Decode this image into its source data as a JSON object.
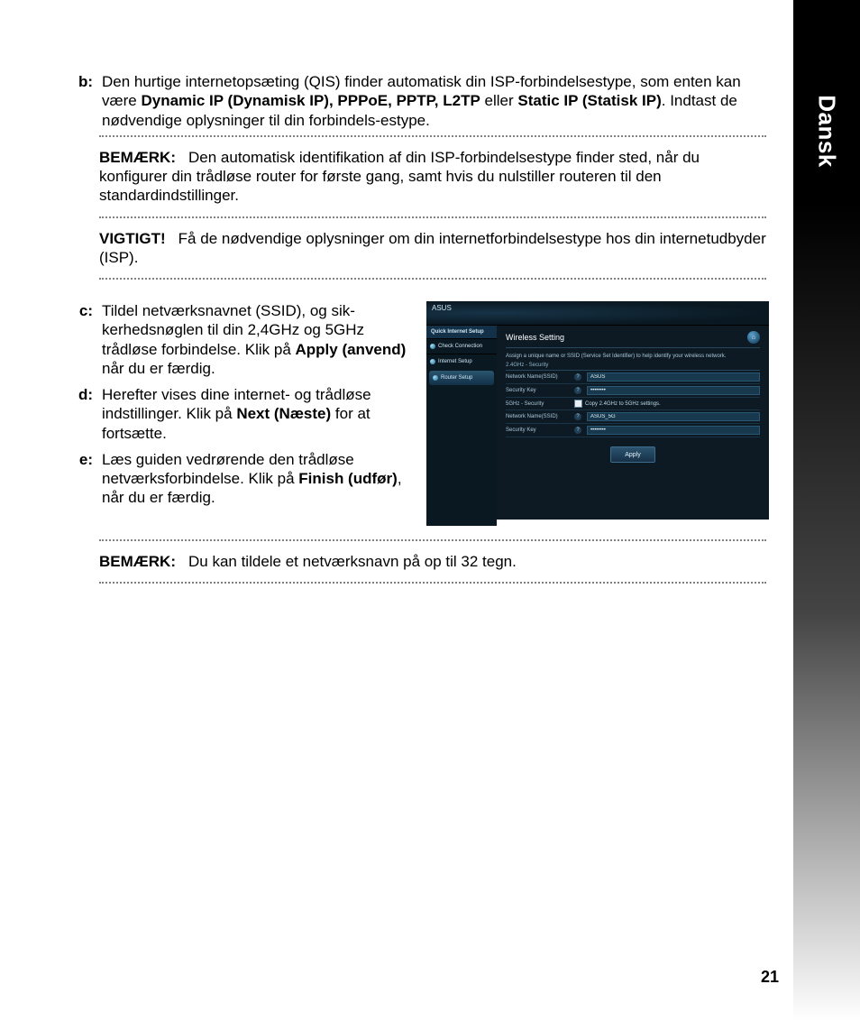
{
  "side_tab": "Dansk",
  "page_number": "21",
  "steps": {
    "b": {
      "label": "b:",
      "text_pre": "Den hurtige internetopsæting (QIS) finder automatisk din ISP-forbindelsestype, som enten kan være ",
      "bold1": "Dynamic IP (Dynamisk IP), PPPoE, PPTP, L2TP",
      "mid": " eller ",
      "bold2": "Static IP (Statisk IP)",
      "text_post": ". Indtast de nødvendige oplysninger til din forbindels-estype."
    },
    "c": {
      "label": "c:",
      "p1": "Tildel netværksnavnet (SSID), og sik-kerhedsnøglen til din 2,4GHz og 5GHz trådløse forbindelse. Klik på ",
      "b1": "Apply (anvend)",
      "p2": " når du er færdig."
    },
    "d": {
      "label": "d:",
      "p1": "Herefter vises dine internet- og trådløse indstillinger. Klik på ",
      "b1": "Next (Næste)",
      "p2": " for at fortsætte."
    },
    "e": {
      "label": "e:",
      "p1": "Læs guiden vedrørende den trådløse netværksforbindelse. Klik på ",
      "b1": "Finish (udfør)",
      "p2": ", når du er færdig."
    }
  },
  "notes": {
    "n1_label": "BEMÆRK:",
    "n1_text": "Den automatisk identifikation af din ISP-forbindelsestype finder sted, når du konfigurer din trådløse router for første gang, samt hvis du nulstiller routeren til den standardindstillinger.",
    "n2_label": "VIGTIGT!",
    "n2_text": "Få de nødvendige oplysninger om din internetforbindelsestype hos din internetudbyder (ISP).",
    "n3_label": "BEMÆRK:",
    "n3_text": "Du kan tildele et netværksnavn på op til 32 tegn."
  },
  "router": {
    "brand": "ASUS",
    "qis_title": "Quick Internet Setup",
    "qis_items": [
      "Check Connection",
      "Internet Setup",
      "Router Setup"
    ],
    "panel_title": "Wireless Setting",
    "hint": "Assign a unique name or SSID (Service Set Identifier) to help identify your wireless network.",
    "section24": "2.4GHz - Security",
    "section5": "5GHz - Security",
    "lbl_ssid": "Network Name(SSID)",
    "lbl_key": "Security Key",
    "ssid24": "ASUS",
    "key_dots": "••••••••",
    "copy_label": "Copy 2.4GHz to 5GHz settings.",
    "ssid5": "ASUS_5G",
    "apply": "Apply",
    "home_glyph": "⌂"
  }
}
